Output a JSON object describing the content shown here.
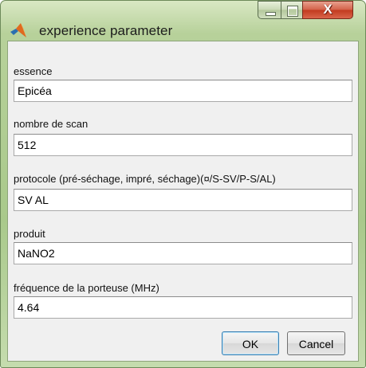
{
  "window": {
    "title": "experience parameter",
    "icon": "matlab-logo-icon",
    "controls": {
      "minimize": "minimize-icon",
      "maximize": "maximize-icon",
      "close_label": "X"
    }
  },
  "fields": [
    {
      "label": "essence",
      "value": "Epicéa"
    },
    {
      "label": "nombre de scan",
      "value": "512"
    },
    {
      "label": "protocole (pré-séchage, impré, séchage)(¤/S-SV/P-S/AL)",
      "value": "SV AL"
    },
    {
      "label": "produit",
      "value": "NaNO2"
    },
    {
      "label": "fréquence de la porteuse (MHz)",
      "value": "4.64"
    }
  ],
  "buttons": {
    "ok": "OK",
    "cancel": "Cancel"
  },
  "colors": {
    "frame": "#b7d19a",
    "close": "#c23a1f",
    "ok_border": "#3c7fb1",
    "client": "#f0f0f0"
  }
}
